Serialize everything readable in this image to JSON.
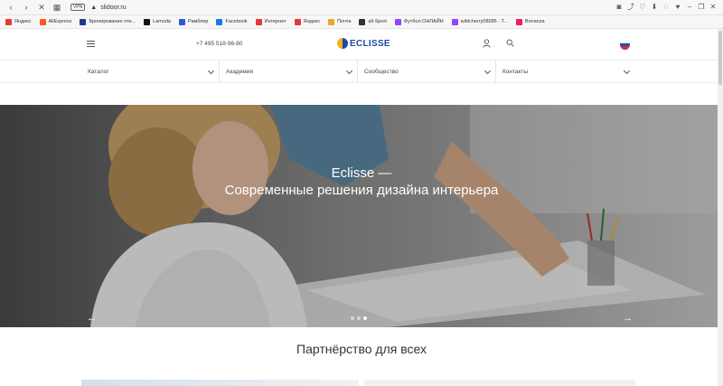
{
  "browser": {
    "url": "slidoor.ru",
    "vpn_label": "VPN",
    "bookmarks": [
      {
        "label": "Яндекс",
        "color": "#e53935"
      },
      {
        "label": "AliExpress",
        "color": "#ff5722"
      },
      {
        "label": "Бронирование оте...",
        "color": "#1e3a8a"
      },
      {
        "label": "Lamoda",
        "color": "#111111"
      },
      {
        "label": "Рамблер",
        "color": "#2a5bd7"
      },
      {
        "label": "Facebook",
        "color": "#1877f2"
      },
      {
        "label": "Интернет",
        "color": "#e53935"
      },
      {
        "label": "Яндекс",
        "color": "#e53935"
      },
      {
        "label": "Почта",
        "color": "#f4a62a"
      },
      {
        "label": "all-Sport",
        "color": "#333333"
      },
      {
        "label": "Футбол ОНЛАЙН",
        "color": "#9146ff"
      },
      {
        "label": "wildcherry08085 - T...",
        "color": "#9146ff"
      },
      {
        "label": "Bonanza",
        "color": "#e91e63"
      }
    ]
  },
  "header": {
    "phone": "+7 495 518-96-80",
    "logo_text": "ECLISSE",
    "brand_blue": "#1a4aa3",
    "brand_yellow": "#f3b11c"
  },
  "nav": {
    "items": [
      {
        "label": "Каталог"
      },
      {
        "label": "Академия"
      },
      {
        "label": "Сообщество"
      },
      {
        "label": "Контакты"
      }
    ]
  },
  "hero": {
    "title": "Eclisse —",
    "subtitle": "Современные решения дизайна интерьера",
    "prev_icon": "arrow-left-icon",
    "next_icon": "arrow-right-icon",
    "slides_total": 3,
    "active_slide": 3
  },
  "section": {
    "title": "Партнёрство для всех"
  }
}
